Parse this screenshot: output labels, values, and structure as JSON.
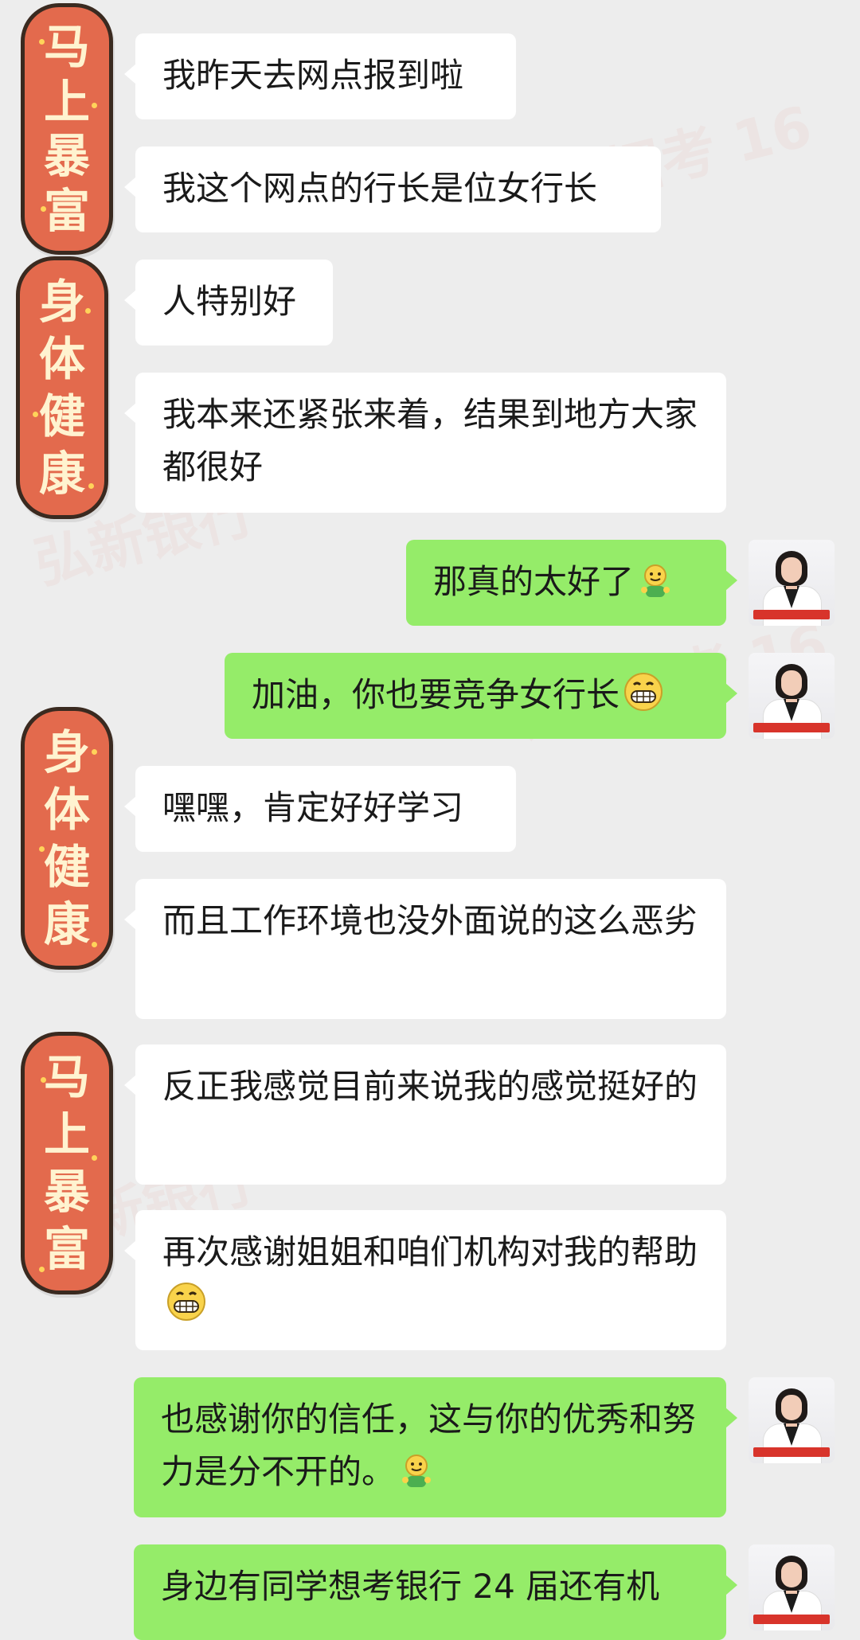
{
  "stickers": [
    {
      "chars": [
        "马",
        "上",
        "暴",
        "富"
      ]
    },
    {
      "chars": [
        "身",
        "体",
        "健",
        "康"
      ]
    },
    {
      "chars": [
        "身",
        "体",
        "健",
        "康"
      ]
    },
    {
      "chars": [
        "马",
        "上",
        "暴",
        "富"
      ]
    }
  ],
  "messages": [
    {
      "side": "incoming",
      "text": "我昨天去网点报到啦"
    },
    {
      "side": "incoming",
      "text": "我这个网点的行长是位女行长"
    },
    {
      "side": "incoming",
      "text": "人特别好"
    },
    {
      "side": "incoming",
      "text": "我本来还紧张来着，结果到地方大家都很好"
    },
    {
      "side": "outgoing",
      "text": "那真的太好了",
      "emoji": "thumbs-up-emoji"
    },
    {
      "side": "outgoing",
      "text": "加油，你也要竞争女行长",
      "emoji": "grin-emoji"
    },
    {
      "side": "incoming",
      "text": "嘿嘿，肯定好好学习"
    },
    {
      "side": "incoming",
      "text": "而且工作环境也没外面说的这么恶劣"
    },
    {
      "side": "incoming",
      "text": "反正我感觉目前来说我的感觉挺好的"
    },
    {
      "side": "incoming",
      "text": "再次感谢姐姐和咱们机构对我的帮助",
      "emoji": "grin-emoji"
    },
    {
      "side": "outgoing",
      "text": "也感谢你的信任，这与你的优秀和努力是分不开的。",
      "emoji": "thumbs-up-emoji"
    },
    {
      "side": "outgoing",
      "text": "身边有同学想考银行 24 届还有机"
    }
  ],
  "colors": {
    "background": "#ededed",
    "incoming_bubble": "#ffffff",
    "outgoing_bubble": "#95ec69",
    "sticker_fill": "#e36a4d",
    "sticker_text": "#fff3d0"
  }
}
